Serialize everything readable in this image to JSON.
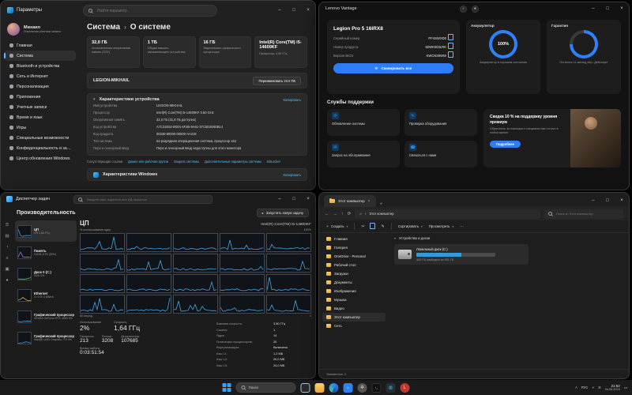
{
  "settings": {
    "app_title": "Параметры",
    "search_placeholder": "Найти параметр",
    "user": {
      "name": "Михаил",
      "subtitle": "Локальная учетная запись"
    },
    "sidebar": [
      {
        "label": "Главная"
      },
      {
        "label": "Система",
        "active": true
      },
      {
        "label": "Bluetooth и устройства"
      },
      {
        "label": "Сеть и Интернет"
      },
      {
        "label": "Персонализация"
      },
      {
        "label": "Приложения"
      },
      {
        "label": "Учетные записи"
      },
      {
        "label": "Время и язык"
      },
      {
        "label": "Игры"
      },
      {
        "label": "Специальные возможности"
      },
      {
        "label": "Конфиденциальность и защита"
      },
      {
        "label": "Центр обновления Windows"
      }
    ],
    "breadcrumb": {
      "root": "Система",
      "sep": "›",
      "page": "О системе"
    },
    "cards": [
      {
        "value": "32,0 ГБ",
        "label": "Установленная оперативная память (ОЗУ)"
      },
      {
        "value": "1 ТБ",
        "label": "Общая емкость запоминающего устройства"
      },
      {
        "value": "16 ГБ",
        "label": "Видеопамять графического процессора"
      },
      {
        "value": "Intel(R) Core(TM) i5-14600KF",
        "label": "Процессор, 3,50 ГГц"
      }
    ],
    "device_bar": {
      "name": "LEGION-MIKHAIL",
      "rename_button": "Переименовать этот ПК"
    },
    "specs": {
      "title": "Характеристики устройства",
      "copy": "Копировать",
      "rows": [
        {
          "k": "Имя устройства",
          "v": "LEGION-MIKHAIL"
        },
        {
          "k": "Процессор",
          "v": "Intel(R) Core(TM) i5-14600KF  3.50 GHz"
        },
        {
          "k": "Оперативная память",
          "v": "32,0 ГБ (31,8 ГБ доступно)"
        },
        {
          "k": "Код устройства",
          "v": "A7C31E52-8D04-4F2B-9A61-37C5D2E90B14"
        },
        {
          "k": "Код продукта",
          "v": "00330-80000-00000-AA218"
        },
        {
          "k": "Тип системы",
          "v": "64-разрядная операционная система, процессор x64"
        },
        {
          "k": "Перо и сенсорный ввод",
          "v": "Перо и сенсорный ввод недоступны для этого монитора"
        }
      ]
    },
    "related": {
      "title": "Сопутствующие ссылки",
      "links": [
        "Домен или рабочая группа",
        "Защита системы",
        "Дополнительные параметры системы",
        "BitLocker"
      ]
    },
    "win_specs": {
      "title": "Характеристики Windows",
      "copy": "Копировать"
    }
  },
  "vantage": {
    "title": "Lenovo Vantage",
    "device": {
      "name": "Legion Pro 5 16IRX8",
      "rows": [
        {
          "k": "Серийный номер",
          "v": "PF4SWXD0"
        },
        {
          "k": "Номер продукта",
          "v": "82WK003LRK"
        },
        {
          "k": "Версия BIOS",
          "v": "KWCN39WW"
        }
      ],
      "scan_button": "Сканировать все"
    },
    "battery": {
      "title": "Аккумулятор",
      "value": "100%",
      "sub": "Аккумулятор в хорошем состоянии"
    },
    "warranty": {
      "title": "Гарантия",
      "sub": "Осталось 11 месяц(-ев) • Действует"
    },
    "support": {
      "title": "Службы поддержки",
      "tiles": [
        {
          "label": "Обновление системы",
          "glyph": "⟳"
        },
        {
          "label": "Проверка оборудования",
          "glyph": "✎"
        },
        {
          "label": "Запрос на обслуживание",
          "glyph": "✉"
        },
        {
          "label": "Связаться с нами",
          "glyph": "☎"
        }
      ]
    },
    "promo": {
      "title": "Скидка 10 % на поддержку уровня премиум",
      "body": "Обратитесь за помощью к специалистам Lenovo в любое время",
      "button": "Подробнее"
    },
    "accent": "#2e7cf6"
  },
  "taskman": {
    "title": "Диспетчер задач",
    "search_placeholder": "Введите имя, издателя или ИД процесса",
    "page_title": "Производительность",
    "run_task": "Запустить новую задачу",
    "sidebar": [
      {
        "label": "ЦП",
        "sub": "2%  1,64 ГГц",
        "color": "#4aa3df",
        "active": true
      },
      {
        "label": "Память",
        "sub": "9,6/31,8 ГБ (30%)",
        "color": "#a06ee0"
      },
      {
        "label": "Диск 0 (C:)",
        "sub": "SSD  0%",
        "color": "#5cb85c"
      },
      {
        "label": "Ethernet",
        "sub": "О: 0  П: 0 Кбит/с",
        "color": "#d9a15b"
      },
      {
        "label": "Графический процессор 0",
        "sub": "NVIDIA GeForce RTX 4060  0%",
        "color": "#4aa3df"
      },
      {
        "label": "Графический процессор 1",
        "sub": "Intel(R) UHD Graphics 770  0%",
        "color": "#4aa3df"
      }
    ],
    "cpu": {
      "title": "ЦП",
      "name": "Intel(R) Core(TM) i5-14600KF",
      "graph_label": "% использования ядер",
      "scale_top": "100%",
      "axis_left": "60 секунд",
      "axis_right": "0",
      "big": [
        {
          "k": "Использование",
          "v": "2%"
        },
        {
          "k": "Скорость",
          "v": "1,64 ГГц"
        }
      ],
      "mid": [
        {
          "k": "Процессы",
          "v": "213"
        },
        {
          "k": "Потоки",
          "v": "3208"
        },
        {
          "k": "Дескрипторы",
          "v": "107685"
        }
      ],
      "uptime": {
        "k": "Время работы",
        "v": "0:03:51:54"
      },
      "right": [
        {
          "k": "Базовая скорость:",
          "v": "3,50 ГГц"
        },
        {
          "k": "Сокеты:",
          "v": "1"
        },
        {
          "k": "Ядра:",
          "v": "14"
        },
        {
          "k": "Логических процессоров:",
          "v": "20"
        },
        {
          "k": "Виртуализация:",
          "v": "Включено"
        },
        {
          "k": "Кэш L1:",
          "v": "1,2 МБ"
        },
        {
          "k": "Кэш L2:",
          "v": "20,0 МБ"
        },
        {
          "k": "Кэш L3:",
          "v": "24,0 МБ"
        }
      ]
    }
  },
  "explorer": {
    "tab": "Этот компьютер",
    "address": "Этот компьютер",
    "search_placeholder": "Поиск в: Этот компьютер",
    "toolbar": {
      "new": "Создать",
      "sort": "Сортировать",
      "view": "Просмотреть"
    },
    "nav": [
      {
        "label": "Главная"
      },
      {
        "label": "Галерея"
      },
      {
        "label": "OneDrive - Personal"
      },
      {
        "label": "Рабочий стол"
      },
      {
        "label": "Загрузки"
      },
      {
        "label": "Документы"
      },
      {
        "label": "Изображения"
      },
      {
        "label": "Музыка"
      },
      {
        "label": "Видео"
      },
      {
        "label": "Этот компьютер",
        "active": true
      },
      {
        "label": "Сеть"
      }
    ],
    "group": "Устройства и диски",
    "drive": {
      "name": "Локальный диск (C:)",
      "free": "402 ГБ свободно из 931 ГБ",
      "used_pct": 57
    },
    "status": "Элементов: 1"
  },
  "taskbar": {
    "search": "Поиск",
    "tray": {
      "lang": "РУС",
      "time": "21:52",
      "date": "04.05.2024"
    }
  }
}
